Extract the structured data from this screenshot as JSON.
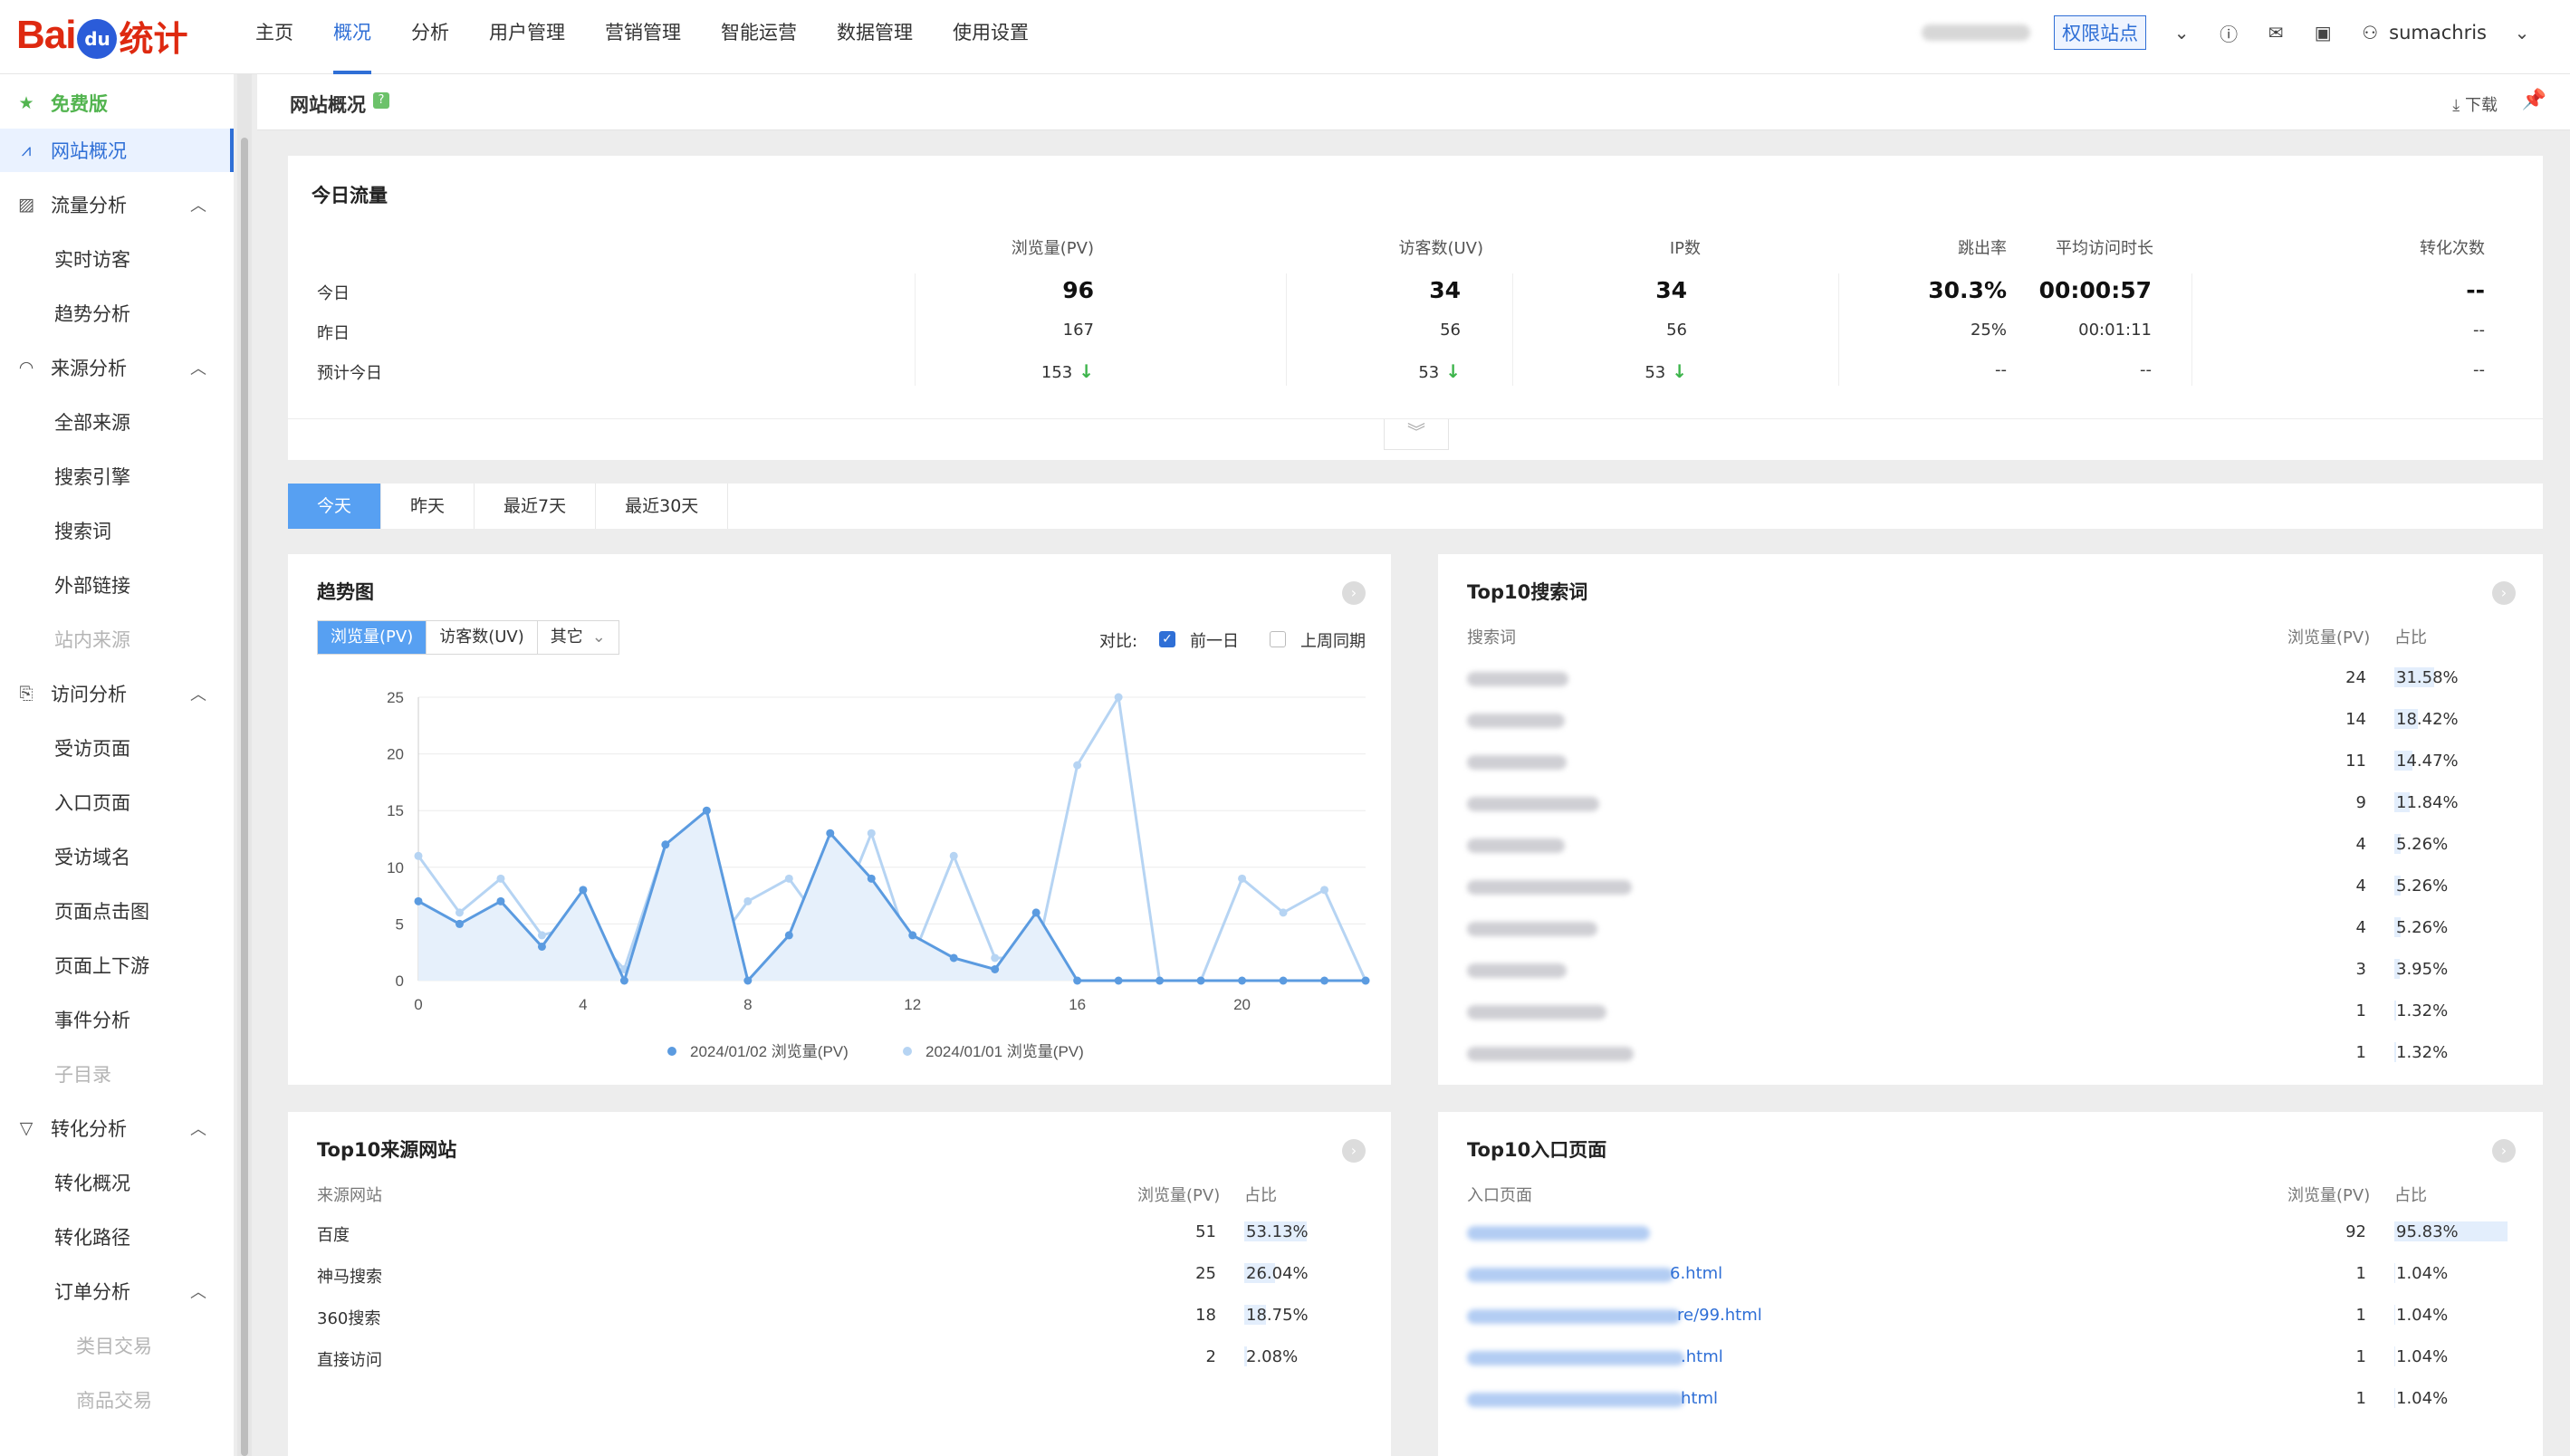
{
  "nav": {
    "logo_bai": "Bai",
    "logo_du": "du",
    "logo_tj": "统计",
    "items": [
      "主页",
      "概况",
      "分析",
      "用户管理",
      "营销管理",
      "智能运营",
      "数据管理",
      "使用设置"
    ],
    "active_index": 1,
    "perm_label": "权限站点",
    "user": "sumachris"
  },
  "sidebar": {
    "free": "免费版",
    "items": [
      {
        "label": "网站概况",
        "kind": "top",
        "icon": "line-chart-icon",
        "active": true
      },
      {
        "label": "流量分析",
        "kind": "top",
        "icon": "image-chart-icon",
        "expanded": true
      },
      {
        "label": "实时访客",
        "kind": "child"
      },
      {
        "label": "趋势分析",
        "kind": "child"
      },
      {
        "label": "来源分析",
        "kind": "top",
        "icon": "signal-icon",
        "expanded": true
      },
      {
        "label": "全部来源",
        "kind": "child"
      },
      {
        "label": "搜索引擎",
        "kind": "child"
      },
      {
        "label": "搜索词",
        "kind": "child"
      },
      {
        "label": "外部链接",
        "kind": "child"
      },
      {
        "label": "站内来源",
        "kind": "child",
        "disabled": true
      },
      {
        "label": "访问分析",
        "kind": "top",
        "icon": "exit-icon",
        "expanded": true
      },
      {
        "label": "受访页面",
        "kind": "child"
      },
      {
        "label": "入口页面",
        "kind": "child"
      },
      {
        "label": "受访域名",
        "kind": "child"
      },
      {
        "label": "页面点击图",
        "kind": "child"
      },
      {
        "label": "页面上下游",
        "kind": "child"
      },
      {
        "label": "事件分析",
        "kind": "child"
      },
      {
        "label": "子目录",
        "kind": "child",
        "disabled": true
      },
      {
        "label": "转化分析",
        "kind": "top",
        "icon": "filter-icon",
        "expanded": true
      },
      {
        "label": "转化概况",
        "kind": "child"
      },
      {
        "label": "转化路径",
        "kind": "child"
      },
      {
        "label": "订单分析",
        "kind": "child",
        "expanded": true
      },
      {
        "label": "类目交易",
        "kind": "grandchild",
        "disabled": true
      },
      {
        "label": "商品交易",
        "kind": "grandchild",
        "disabled": true
      }
    ]
  },
  "page": {
    "title": "网站概况",
    "download": "下载"
  },
  "today": {
    "title": "今日流量",
    "headers": [
      "浏览量(PV)",
      "访客数(UV)",
      "IP数",
      "跳出率",
      "平均访问时长",
      "转化次数"
    ],
    "rows": [
      {
        "label": "今日",
        "values": [
          "96",
          "34",
          "34",
          "30.3%",
          "00:00:57",
          "--"
        ]
      },
      {
        "label": "昨日",
        "values": [
          "167",
          "56",
          "56",
          "25%",
          "00:01:11",
          "--"
        ]
      },
      {
        "label": "预计今日",
        "values": [
          "153",
          "53",
          "53",
          "--",
          "--",
          "--"
        ]
      }
    ]
  },
  "date_tabs": [
    "今天",
    "昨天",
    "最近7天",
    "最近30天"
  ],
  "trend": {
    "title": "趋势图",
    "metric_tabs": [
      "浏览量(PV)",
      "访客数(UV)",
      "其它"
    ],
    "compare_label": "对比:",
    "compare_prev_day": "前一日",
    "compare_last_week": "上周同期",
    "chart_data": {
      "type": "line",
      "x": [
        0,
        1,
        2,
        3,
        4,
        5,
        6,
        7,
        8,
        9,
        10,
        11,
        12,
        13,
        14,
        15,
        16,
        17,
        18,
        19,
        20,
        21,
        22,
        23
      ],
      "x_ticks": [
        0,
        4,
        8,
        12,
        16,
        20
      ],
      "y_ticks": [
        0,
        5,
        10,
        15,
        20,
        25
      ],
      "ylim": [
        0,
        25
      ],
      "series": [
        {
          "name": "2024/01/02 浏览量(PV)",
          "color": "#5b9be0",
          "area": true,
          "values": [
            7,
            5,
            7,
            3,
            8,
            0,
            12,
            15,
            0,
            4,
            13,
            9,
            4,
            2,
            1,
            6,
            0,
            0,
            0,
            0,
            0,
            0,
            0,
            0
          ]
        },
        {
          "name": "2024/01/01 浏览量(PV)",
          "color": "#b6d4f3",
          "area": false,
          "values": [
            11,
            6,
            9,
            4,
            5,
            1,
            12,
            2,
            7,
            9,
            4,
            13,
            2,
            11,
            2,
            2,
            19,
            25,
            0,
            0,
            9,
            6,
            8,
            0
          ]
        }
      ]
    }
  },
  "search_words": {
    "title": "Top10搜索词",
    "headers": [
      "搜索词",
      "浏览量(PV)",
      "占比"
    ],
    "rows": [
      {
        "pv": "24",
        "pct": "31.58%",
        "ratio": 0.3158
      },
      {
        "pv": "14",
        "pct": "18.42%",
        "ratio": 0.1842
      },
      {
        "pv": "11",
        "pct": "14.47%",
        "ratio": 0.1447
      },
      {
        "pv": "9",
        "pct": "11.84%",
        "ratio": 0.1184
      },
      {
        "pv": "4",
        "pct": "5.26%",
        "ratio": 0.0526
      },
      {
        "pv": "4",
        "pct": "5.26%",
        "ratio": 0.0526
      },
      {
        "pv": "4",
        "pct": "5.26%",
        "ratio": 0.0526
      },
      {
        "pv": "3",
        "pct": "3.95%",
        "ratio": 0.0395
      },
      {
        "pv": "1",
        "pct": "1.32%",
        "ratio": 0.0132
      },
      {
        "pv": "1",
        "pct": "1.32%",
        "ratio": 0.0132
      }
    ]
  },
  "sources": {
    "title": "Top10来源网站",
    "headers": [
      "来源网站",
      "浏览量(PV)",
      "占比"
    ],
    "rows": [
      {
        "name": "百度",
        "pv": "51",
        "pct": "53.13%",
        "ratio": 0.5313
      },
      {
        "name": "神马搜索",
        "pv": "25",
        "pct": "26.04%",
        "ratio": 0.2604
      },
      {
        "name": "360搜索",
        "pv": "18",
        "pct": "18.75%",
        "ratio": 0.1875
      },
      {
        "name": "直接访问",
        "pv": "2",
        "pct": "2.08%",
        "ratio": 0.0208
      }
    ]
  },
  "entries": {
    "title": "Top10入口页面",
    "headers": [
      "入口页面",
      "浏览量(PV)",
      "占比"
    ],
    "rows": [
      {
        "tail": "",
        "pv": "92",
        "pct": "95.83%",
        "ratio": 0.9583
      },
      {
        "tail": "6.html",
        "pv": "1",
        "pct": "1.04%",
        "ratio": 0.0104
      },
      {
        "tail": "re/99.html",
        "pv": "1",
        "pct": "1.04%",
        "ratio": 0.0104
      },
      {
        "tail": ".html",
        "pv": "1",
        "pct": "1.04%",
        "ratio": 0.0104
      },
      {
        "tail": "html",
        "pv": "1",
        "pct": "1.04%",
        "ratio": 0.0104
      }
    ]
  }
}
